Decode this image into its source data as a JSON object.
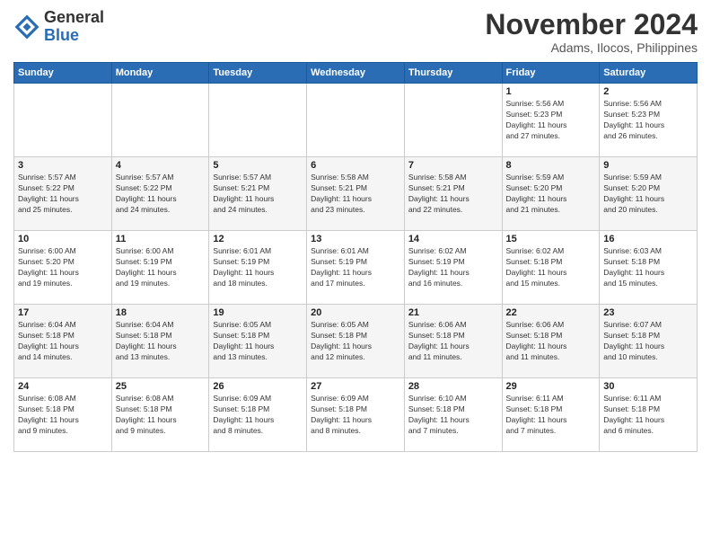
{
  "logo": {
    "general": "General",
    "blue": "Blue"
  },
  "title": "November 2024",
  "subtitle": "Adams, Ilocos, Philippines",
  "weekdays": [
    "Sunday",
    "Monday",
    "Tuesday",
    "Wednesday",
    "Thursday",
    "Friday",
    "Saturday"
  ],
  "weeks": [
    [
      {
        "day": "",
        "info": ""
      },
      {
        "day": "",
        "info": ""
      },
      {
        "day": "",
        "info": ""
      },
      {
        "day": "",
        "info": ""
      },
      {
        "day": "",
        "info": ""
      },
      {
        "day": "1",
        "info": "Sunrise: 5:56 AM\nSunset: 5:23 PM\nDaylight: 11 hours\nand 27 minutes."
      },
      {
        "day": "2",
        "info": "Sunrise: 5:56 AM\nSunset: 5:23 PM\nDaylight: 11 hours\nand 26 minutes."
      }
    ],
    [
      {
        "day": "3",
        "info": "Sunrise: 5:57 AM\nSunset: 5:22 PM\nDaylight: 11 hours\nand 25 minutes."
      },
      {
        "day": "4",
        "info": "Sunrise: 5:57 AM\nSunset: 5:22 PM\nDaylight: 11 hours\nand 24 minutes."
      },
      {
        "day": "5",
        "info": "Sunrise: 5:57 AM\nSunset: 5:21 PM\nDaylight: 11 hours\nand 24 minutes."
      },
      {
        "day": "6",
        "info": "Sunrise: 5:58 AM\nSunset: 5:21 PM\nDaylight: 11 hours\nand 23 minutes."
      },
      {
        "day": "7",
        "info": "Sunrise: 5:58 AM\nSunset: 5:21 PM\nDaylight: 11 hours\nand 22 minutes."
      },
      {
        "day": "8",
        "info": "Sunrise: 5:59 AM\nSunset: 5:20 PM\nDaylight: 11 hours\nand 21 minutes."
      },
      {
        "day": "9",
        "info": "Sunrise: 5:59 AM\nSunset: 5:20 PM\nDaylight: 11 hours\nand 20 minutes."
      }
    ],
    [
      {
        "day": "10",
        "info": "Sunrise: 6:00 AM\nSunset: 5:20 PM\nDaylight: 11 hours\nand 19 minutes."
      },
      {
        "day": "11",
        "info": "Sunrise: 6:00 AM\nSunset: 5:19 PM\nDaylight: 11 hours\nand 19 minutes."
      },
      {
        "day": "12",
        "info": "Sunrise: 6:01 AM\nSunset: 5:19 PM\nDaylight: 11 hours\nand 18 minutes."
      },
      {
        "day": "13",
        "info": "Sunrise: 6:01 AM\nSunset: 5:19 PM\nDaylight: 11 hours\nand 17 minutes."
      },
      {
        "day": "14",
        "info": "Sunrise: 6:02 AM\nSunset: 5:19 PM\nDaylight: 11 hours\nand 16 minutes."
      },
      {
        "day": "15",
        "info": "Sunrise: 6:02 AM\nSunset: 5:18 PM\nDaylight: 11 hours\nand 15 minutes."
      },
      {
        "day": "16",
        "info": "Sunrise: 6:03 AM\nSunset: 5:18 PM\nDaylight: 11 hours\nand 15 minutes."
      }
    ],
    [
      {
        "day": "17",
        "info": "Sunrise: 6:04 AM\nSunset: 5:18 PM\nDaylight: 11 hours\nand 14 minutes."
      },
      {
        "day": "18",
        "info": "Sunrise: 6:04 AM\nSunset: 5:18 PM\nDaylight: 11 hours\nand 13 minutes."
      },
      {
        "day": "19",
        "info": "Sunrise: 6:05 AM\nSunset: 5:18 PM\nDaylight: 11 hours\nand 13 minutes."
      },
      {
        "day": "20",
        "info": "Sunrise: 6:05 AM\nSunset: 5:18 PM\nDaylight: 11 hours\nand 12 minutes."
      },
      {
        "day": "21",
        "info": "Sunrise: 6:06 AM\nSunset: 5:18 PM\nDaylight: 11 hours\nand 11 minutes."
      },
      {
        "day": "22",
        "info": "Sunrise: 6:06 AM\nSunset: 5:18 PM\nDaylight: 11 hours\nand 11 minutes."
      },
      {
        "day": "23",
        "info": "Sunrise: 6:07 AM\nSunset: 5:18 PM\nDaylight: 11 hours\nand 10 minutes."
      }
    ],
    [
      {
        "day": "24",
        "info": "Sunrise: 6:08 AM\nSunset: 5:18 PM\nDaylight: 11 hours\nand 9 minutes."
      },
      {
        "day": "25",
        "info": "Sunrise: 6:08 AM\nSunset: 5:18 PM\nDaylight: 11 hours\nand 9 minutes."
      },
      {
        "day": "26",
        "info": "Sunrise: 6:09 AM\nSunset: 5:18 PM\nDaylight: 11 hours\nand 8 minutes."
      },
      {
        "day": "27",
        "info": "Sunrise: 6:09 AM\nSunset: 5:18 PM\nDaylight: 11 hours\nand 8 minutes."
      },
      {
        "day": "28",
        "info": "Sunrise: 6:10 AM\nSunset: 5:18 PM\nDaylight: 11 hours\nand 7 minutes."
      },
      {
        "day": "29",
        "info": "Sunrise: 6:11 AM\nSunset: 5:18 PM\nDaylight: 11 hours\nand 7 minutes."
      },
      {
        "day": "30",
        "info": "Sunrise: 6:11 AM\nSunset: 5:18 PM\nDaylight: 11 hours\nand 6 minutes."
      }
    ]
  ]
}
